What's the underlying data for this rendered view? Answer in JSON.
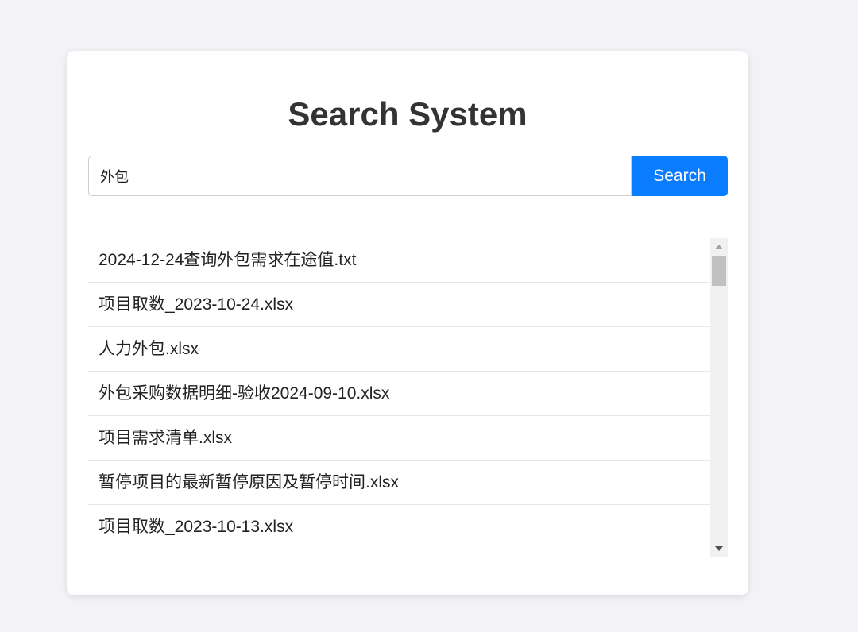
{
  "page": {
    "title": "Search System"
  },
  "search": {
    "value": "外包",
    "button_label": "Search"
  },
  "results": {
    "items": [
      {
        "label": "2024-12-24查询外包需求在途值.txt"
      },
      {
        "label": "项目取数_2023-10-24.xlsx"
      },
      {
        "label": "人力外包.xlsx"
      },
      {
        "label": "外包采购数据明细-验收2024-09-10.xlsx"
      },
      {
        "label": "项目需求清单.xlsx"
      },
      {
        "label": "暂停项目的最新暂停原因及暂停时间.xlsx"
      },
      {
        "label": "项目取数_2023-10-13.xlsx"
      }
    ]
  },
  "colors": {
    "background": "#f3f3f7",
    "card": "#ffffff",
    "accent": "#0a7cff",
    "title_text": "#333333"
  }
}
